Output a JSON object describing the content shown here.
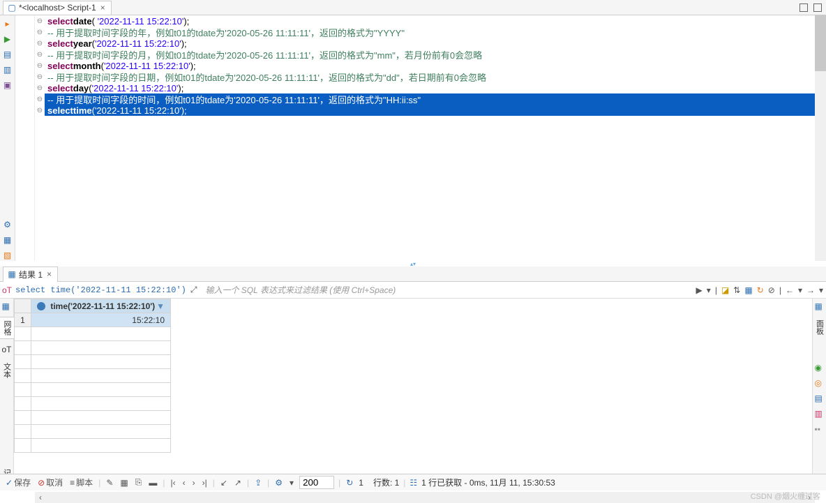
{
  "tabs": {
    "script_tab": "*<localhost> Script-1"
  },
  "code": {
    "l1": {
      "kw": "select",
      "fn": "date",
      "str": "'2022-11-11 15:22:10'",
      "end": ");"
    },
    "l2": "-- 用于提取时间字段的年，例如t01的tdate为'2020-05-26 11:11:11'，返回的格式为\"YYYY\"",
    "l3": {
      "kw": "select",
      "fn": "year",
      "str": "'2022-11-11 15:22:10'",
      "end": ");"
    },
    "l4": "-- 用于提取时间字段的月，例如t01的tdate为'2020-05-26 11:11:11'，返回的格式为\"mm\"，若月份前有0会忽略",
    "l5": {
      "kw": "select",
      "fn": "month",
      "str": "'2022-11-11 15:22:10'",
      "end": ");"
    },
    "l6": "-- 用于提取时间字段的日期，例如t01的tdate为'2020-05-26 11:11:11'，返回的格式为\"dd\"，若日期前有0会忽略",
    "l7": {
      "kw": "select",
      "fn": "day",
      "str": "'2022-11-11 15:22:10'",
      "end": ");"
    },
    "l8": "-- 用于提取时间字段的时间，例如t01的tdate为'2020-05-26 11:11:11'，返回的格式为\"HH:ii:ss\"",
    "l9": {
      "kw": "select",
      "fn": "time",
      "str": "'2022-11-11 15:22:10'",
      "end": ");"
    }
  },
  "results": {
    "tab_label": "结果 1",
    "sql_text": "select time('2022-11-11 15:22:10')",
    "filter_placeholder": "输入一个 SQL 表达式来过滤结果 (使用 Ctrl+Space)",
    "col_header": "time('2022-11-11 15:22:10')",
    "row1_num": "1",
    "row1_val": "15:22:10"
  },
  "vtabs": {
    "grid": "网格",
    "text": "文本",
    "record": "记录"
  },
  "rvtabs": {
    "panels": "面板"
  },
  "status": {
    "save": "保存",
    "cancel": "取消",
    "script": "脚本",
    "page_size": "200",
    "page_num": "1",
    "rows_label": "行数: 1",
    "fetched": "1 行已获取 - 0ms, 11月 11, 15:30:53"
  },
  "watermark": "CSDN @烟火缠过客"
}
